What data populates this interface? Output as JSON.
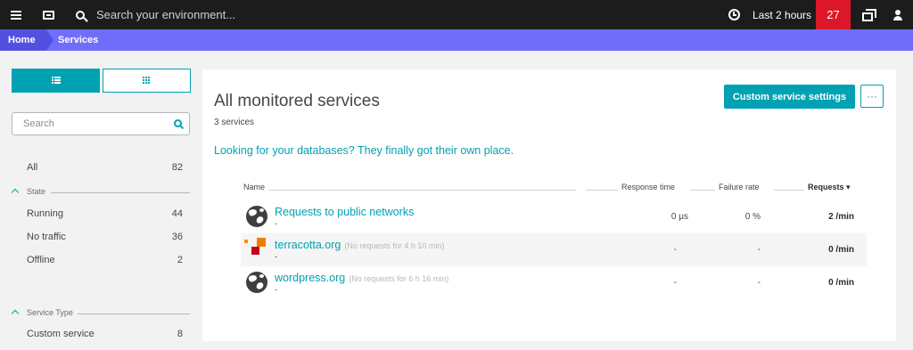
{
  "topbar": {
    "search_placeholder": "Search your environment...",
    "timeframe": "Last 2 hours",
    "problems_count": "27"
  },
  "breadcrumb": {
    "home": "Home",
    "current": "Services"
  },
  "sidebar": {
    "search_placeholder": "Search",
    "all": {
      "label": "All",
      "count": "82"
    },
    "state": {
      "title": "State",
      "items": [
        {
          "label": "Running",
          "count": "44"
        },
        {
          "label": "No traffic",
          "count": "36"
        },
        {
          "label": "Offline",
          "count": "2"
        }
      ]
    },
    "service_type": {
      "title": "Service Type",
      "items": [
        {
          "label": "Custom service",
          "count": "8"
        }
      ]
    }
  },
  "main": {
    "title": "All monitored services",
    "count": "3 services",
    "custom_button": "Custom service settings",
    "more_button": "···",
    "db_link": "Looking for your databases? They finally got their own place.",
    "columns": {
      "name": "Name",
      "response_time": "Response time",
      "failure_rate": "Failure rate",
      "requests": "Requests ▾"
    },
    "rows": [
      {
        "icon": "globe-icon",
        "name": "Requests to public networks",
        "note": "",
        "sub": "-",
        "response_time": "0 μs",
        "failure_rate": "0 %",
        "requests": "2 /min"
      },
      {
        "icon": "terracotta-logo-icon",
        "name": "terracotta.org",
        "note": "(No requests for 4 h 10 min)",
        "sub": "-",
        "response_time": "-",
        "failure_rate": "-",
        "requests": "0 /min"
      },
      {
        "icon": "globe-icon",
        "name": "wordpress.org",
        "note": "(No requests for 6 h 16 min)",
        "sub": "-",
        "response_time": "-",
        "failure_rate": "-",
        "requests": "0 /min"
      }
    ]
  },
  "colors": {
    "topbar": "#1c1c1c",
    "breadcrumb": "#6f6dfa",
    "accent": "#00a1b2",
    "badge": "#dc172a"
  }
}
